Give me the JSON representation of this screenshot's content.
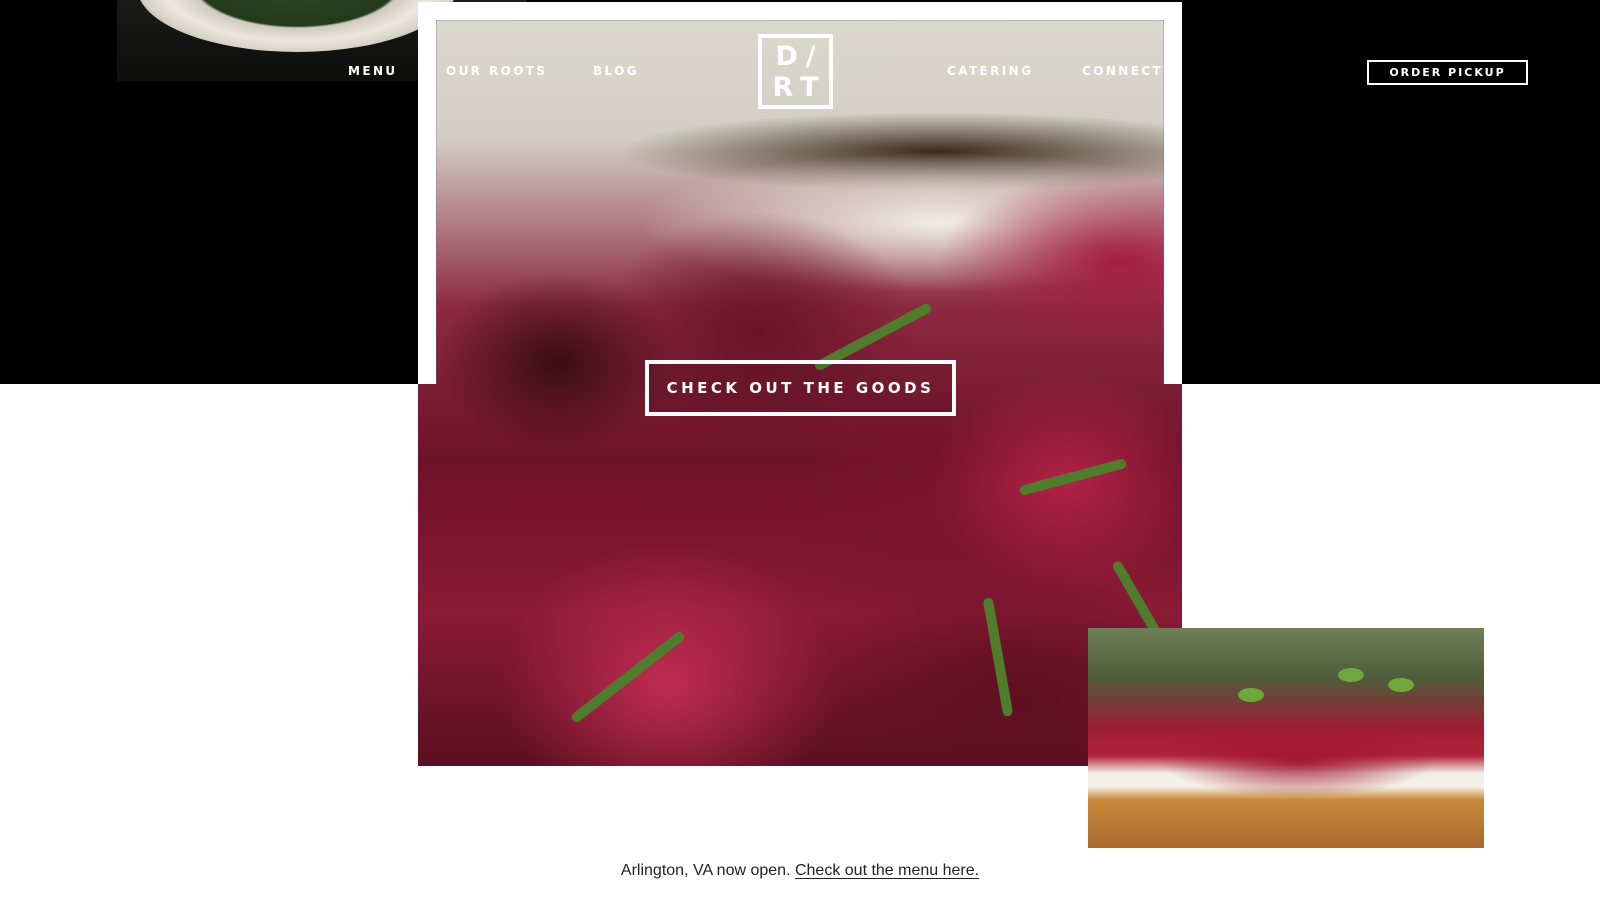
{
  "nav": {
    "left": [
      {
        "label": "MENU"
      },
      {
        "label": "OUR ROOTS"
      },
      {
        "label": "BLOG"
      }
    ],
    "right": [
      {
        "label": "CATERING"
      },
      {
        "label": "CONNECT"
      }
    ],
    "order_label": "ORDER PICKUP"
  },
  "logo": {
    "line1": "D/",
    "line2": "RT"
  },
  "hero": {
    "cta_label": "CHECK OUT THE GOODS"
  },
  "notice": {
    "text": "Arlington, VA now open.",
    "link_label": "Check out the menu here."
  },
  "colors": {
    "band": "#000000",
    "background": "#ffffff",
    "text": "#ffffff",
    "beet": "#8a1a35"
  }
}
